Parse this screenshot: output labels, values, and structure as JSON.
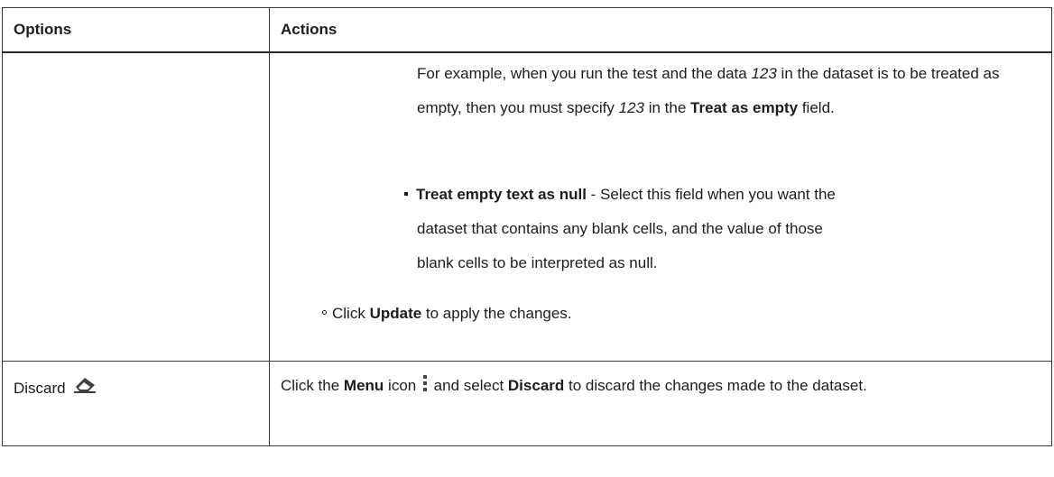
{
  "table": {
    "header": {
      "options": "Options",
      "actions": "Actions"
    },
    "row1": {
      "example": {
        "t1": "For example, when you run the test and the data ",
        "val1": "123",
        "t2": " in the dataset is to be treated as empty, then you must specify ",
        "val2": "123",
        "t3": " in the ",
        "field": "Treat as empty",
        "t4": " field."
      },
      "null_item": {
        "label": "Treat empty text as null",
        "desc_line1": " - Select this field when you want the",
        "desc_line2": "dataset that contains any blank cells, and the value of those",
        "desc_line3": "blank cells to be interpreted as null."
      },
      "update_item": {
        "t1": "Click ",
        "button": "Update",
        "t2": " to apply the changes."
      }
    },
    "row2": {
      "option": "Discard",
      "option_icon": "eraser-icon",
      "action": {
        "t1": "Click the ",
        "menu": "Menu",
        "t2": " icon ",
        "menu_icon": "vertical-ellipsis-icon",
        "t3": " and select ",
        "discard": "Discard",
        "t4": " to discard the changes made to the dataset."
      }
    }
  }
}
